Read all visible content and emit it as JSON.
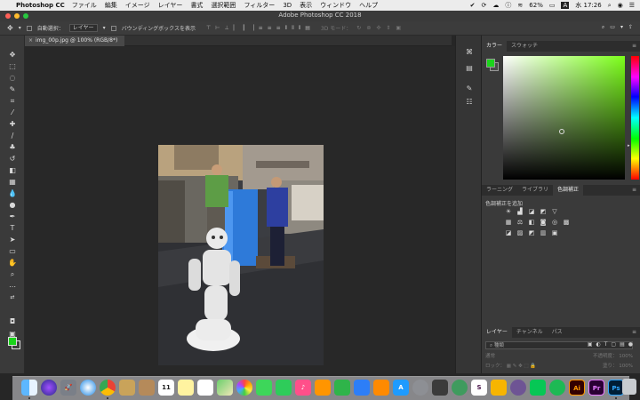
{
  "menubar": {
    "app_name": "Photoshop CC",
    "items": [
      "ファイル",
      "編集",
      "イメージ",
      "レイヤー",
      "書式",
      "選択範囲",
      "フィルター",
      "3D",
      "表示",
      "ウィンドウ",
      "ヘルプ"
    ],
    "battery": "62%",
    "input_mode": "A",
    "clock": "水 17:26"
  },
  "titlebar": {
    "title": "Adobe Photoshop CC 2018"
  },
  "options": {
    "auto_select_label": "自動選択：",
    "auto_select_value": "レイヤー",
    "transform_label": "バウンディングボックスを表示",
    "mode_3d": "3D モード："
  },
  "document": {
    "tab_label": "img_00p.jpg @ 100% (RGB/8*)"
  },
  "color_panel": {
    "tabs": [
      "カラー",
      "スウォッチ"
    ],
    "foreground": "#1bd31b",
    "background": "#404040"
  },
  "adjust_panel": {
    "tabs": [
      "ラーニング",
      "ライブラリ",
      "色調補正"
    ],
    "add_label": "色調補正を追加"
  },
  "layers_panel": {
    "tabs": [
      "レイヤー",
      "チャンネル",
      "パス"
    ],
    "search_placeholder": "種類",
    "blend_mode": "通常",
    "opacity_label": "不透明度：",
    "opacity_value": "100%",
    "lock_label": "ロック：",
    "fill_label": "塗り：",
    "fill_value": "100%"
  }
}
